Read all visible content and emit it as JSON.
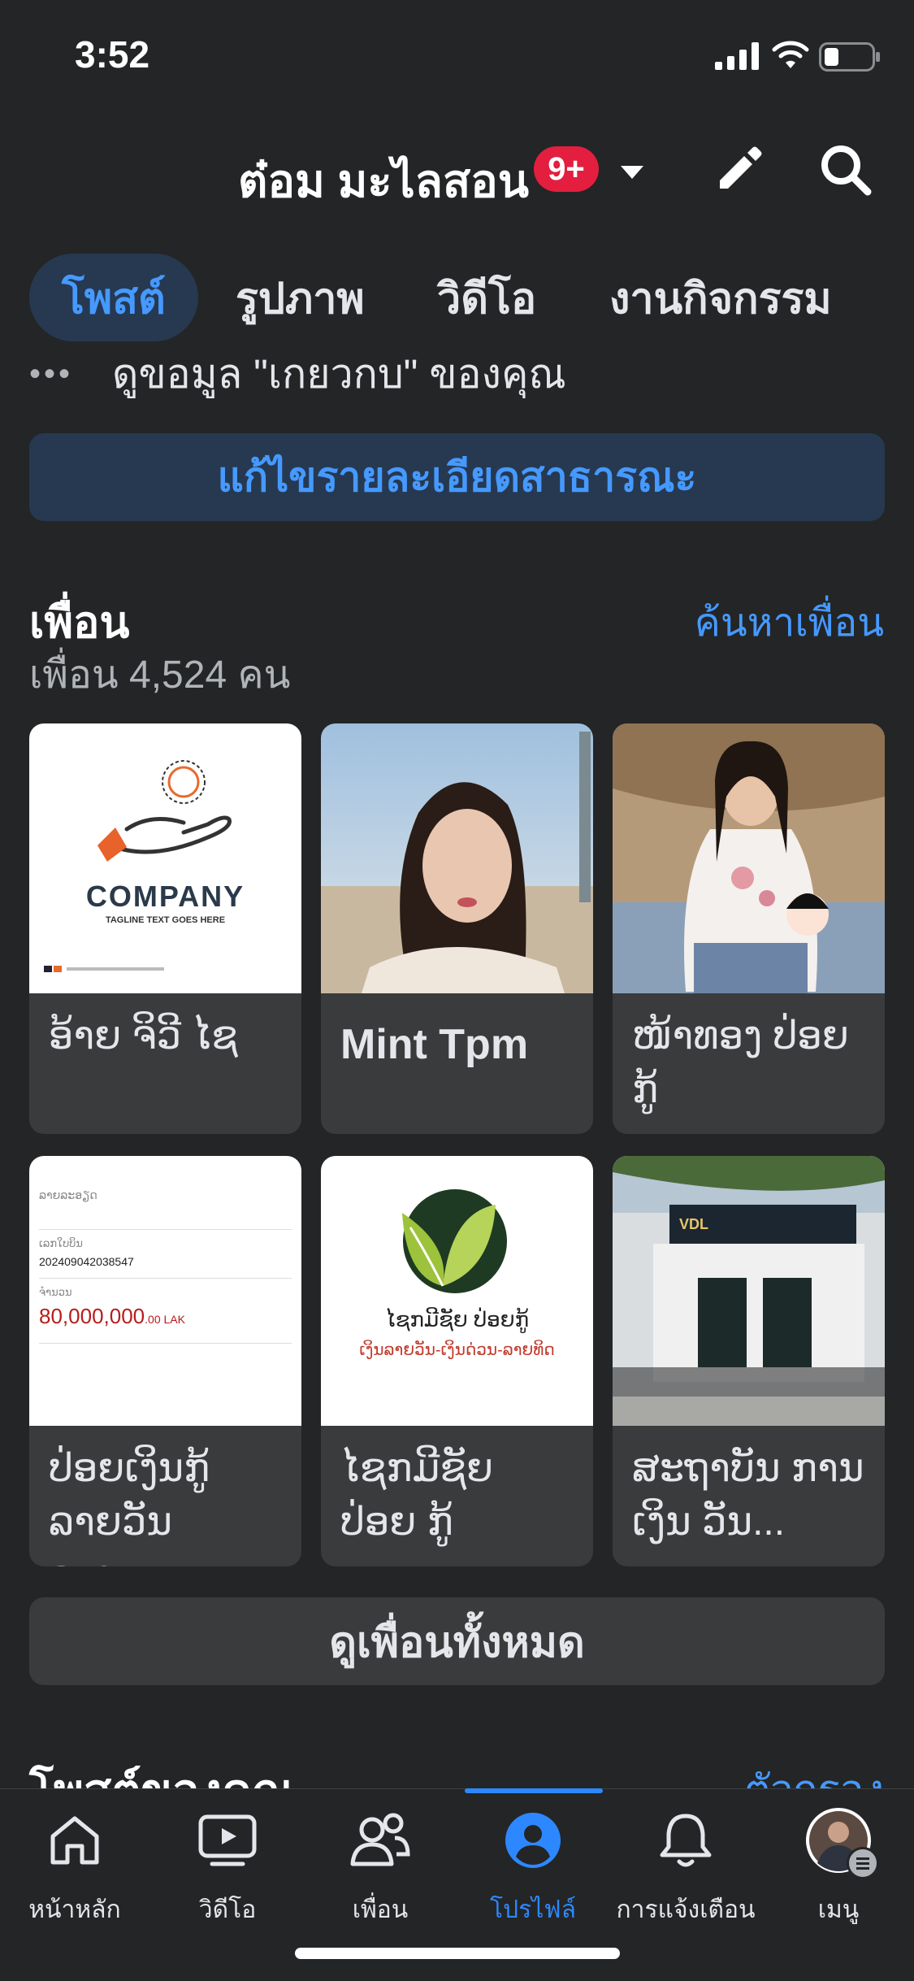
{
  "status_bar": {
    "time": "3:52"
  },
  "header": {
    "title": "ต๋อม มะไลสอน",
    "badge": "9+"
  },
  "tabs": [
    {
      "label": "โพสต์",
      "active": true
    },
    {
      "label": "รูปภาพ",
      "active": false
    },
    {
      "label": "วิดีโอ",
      "active": false
    },
    {
      "label": "งานกิจกรรม",
      "active": false
    }
  ],
  "about": {
    "dots": "•••",
    "text": "ดูขอมูล \"เกยวกบ\" ของคุณ"
  },
  "edit_public_button": "แก้ไขรายละเอียดสาธารณะ",
  "friends": {
    "heading": "เพื่อน",
    "find_link": "ค้นหาเพื่อน",
    "count": "เพื่อน 4,524 คน",
    "cards": [
      {
        "name": "ອ້າຍ ຈິວີ ໄຊ",
        "logo_text": "COMPANY",
        "logo_tagline": "TAGLINE TEXT GOES HERE"
      },
      {
        "name": "Mint Tpm"
      },
      {
        "name": "ໜ້າທອງ ປ່ອຍກູ້"
      },
      {
        "name": "ປ່ອຍເງິນກູ້ ລາຍວັນ ລາຍ...",
        "doc_top": "ລາຍລະອຽດ",
        "doc_ref_label": "ເລກໃບບິນ",
        "doc_ref": "202409042038547",
        "doc_amount_label": "ຈຳນວນ",
        "doc_amount": "80,000,000",
        "doc_amount_suffix": ".00 LAK"
      },
      {
        "name": "ໄຊກມີຊັຍ ປ່ອຍ ກູ້",
        "logo_line1": "ໄຊກມີຊັຍ ປ່ອຍກູ້",
        "logo_line2": "ເງິນລາຍວັນ-ເງິນດ່ວນ-ລາຍທິດ"
      },
      {
        "name": "ສະຖາບັນ ການເງິນ ວັນ...",
        "sign_text": "VDL"
      }
    ],
    "see_all": "ดูเพื่อนทั้งหมด"
  },
  "posts": {
    "heading": "โพสต์ของคุณ",
    "filters": "ตัวกรอง"
  },
  "bottom_nav": [
    {
      "label": "หน้าหลัก",
      "icon": "home-icon"
    },
    {
      "label": "วิดีโอ",
      "icon": "video-icon"
    },
    {
      "label": "เพื่อน",
      "icon": "friends-icon"
    },
    {
      "label": "โปรไฟล์",
      "icon": "profile-icon",
      "active": true
    },
    {
      "label": "การแจ้งเตือน",
      "icon": "bell-icon"
    },
    {
      "label": "เมนู",
      "icon": "menu-avatar-icon"
    }
  ],
  "colors": {
    "background": "#242526",
    "accent": "#4599ff",
    "badge": "#e41e3f",
    "card": "#3a3b3c"
  }
}
